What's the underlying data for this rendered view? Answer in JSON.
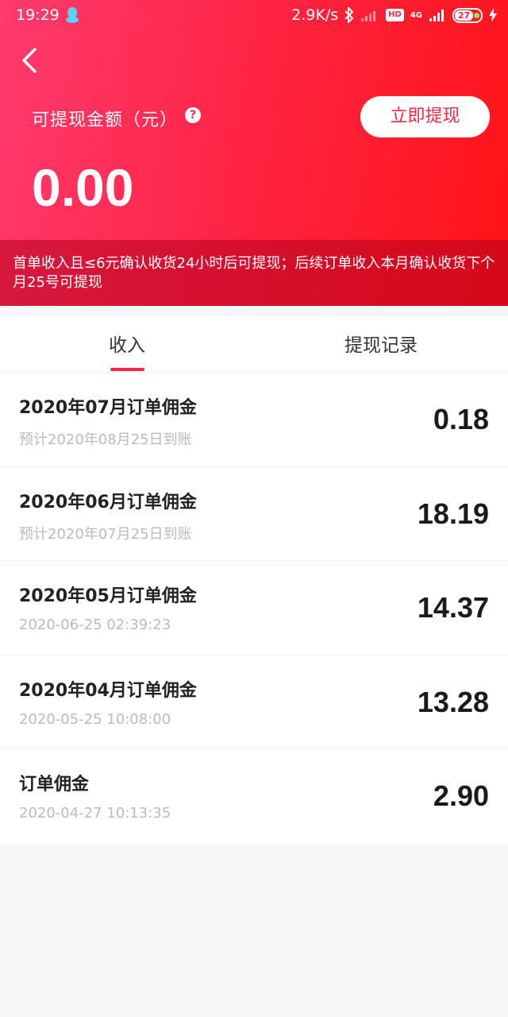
{
  "status": {
    "time": "19:29",
    "net_speed": "2.9K/s",
    "hd": "HD",
    "network": "4G",
    "battery": "27"
  },
  "header": {
    "amount_label": "可提现金额（元）",
    "help": "?",
    "withdraw_button": "立即提现",
    "amount": "0.00",
    "notice": "首单收入且≤6元确认收货24小时后可提现；后续订单收入本月确认收货下个月25号可提现"
  },
  "tabs": [
    {
      "label": "收入",
      "active": true
    },
    {
      "label": "提现记录",
      "active": false
    }
  ],
  "records": [
    {
      "title": "2020年07月订单佣金",
      "sub": "预计2020年08月25日到账",
      "amount": "0.18"
    },
    {
      "title": "2020年06月订单佣金",
      "sub": "预计2020年07月25日到账",
      "amount": "18.19"
    },
    {
      "title": "2020年05月订单佣金",
      "sub": "2020-06-25 02:39:23",
      "amount": "14.37"
    },
    {
      "title": "2020年04月订单佣金",
      "sub": "2020-05-25 10:08:00",
      "amount": "13.28"
    },
    {
      "title": "订单佣金",
      "sub": "2020-04-27 10:13:35",
      "amount": "2.90"
    }
  ],
  "colors": {
    "accent": "#ff2546",
    "header_start": "#ff3a6e",
    "header_end": "#ff1316"
  }
}
